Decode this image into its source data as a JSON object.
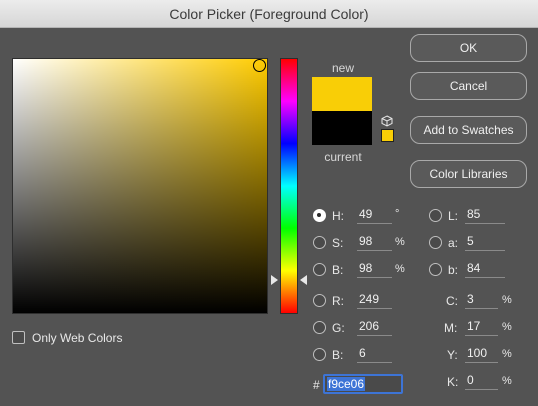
{
  "window": {
    "title": "Color Picker (Foreground Color)"
  },
  "swatches": {
    "new_label": "new",
    "current_label": "current",
    "new_color": "#f9ce06",
    "current_color": "#000000"
  },
  "buttons": {
    "ok": "OK",
    "cancel": "Cancel",
    "add_to_swatches": "Add to Swatches",
    "color_libraries": "Color Libraries"
  },
  "hsb": {
    "h": {
      "label": "H:",
      "value": "49",
      "unit": "°"
    },
    "s": {
      "label": "S:",
      "value": "98",
      "unit": "%"
    },
    "b": {
      "label": "B:",
      "value": "98",
      "unit": "%"
    }
  },
  "rgb": {
    "r": {
      "label": "R:",
      "value": "249"
    },
    "g": {
      "label": "G:",
      "value": "206"
    },
    "b": {
      "label": "B:",
      "value": "6"
    }
  },
  "lab": {
    "l": {
      "label": "L:",
      "value": "85"
    },
    "a": {
      "label": "a:",
      "value": "5"
    },
    "b": {
      "label": "b:",
      "value": "84"
    }
  },
  "cmyk": {
    "c": {
      "label": "C:",
      "value": "3",
      "unit": "%"
    },
    "m": {
      "label": "M:",
      "value": "17",
      "unit": "%"
    },
    "y": {
      "label": "Y:",
      "value": "100",
      "unit": "%"
    },
    "k": {
      "label": "K:",
      "value": "0",
      "unit": "%"
    }
  },
  "hex": {
    "label": "#",
    "value": "f9ce06"
  },
  "web_colors": {
    "label": "Only Web Colors",
    "checked": false
  },
  "icons": {
    "cube": "cube-icon"
  }
}
